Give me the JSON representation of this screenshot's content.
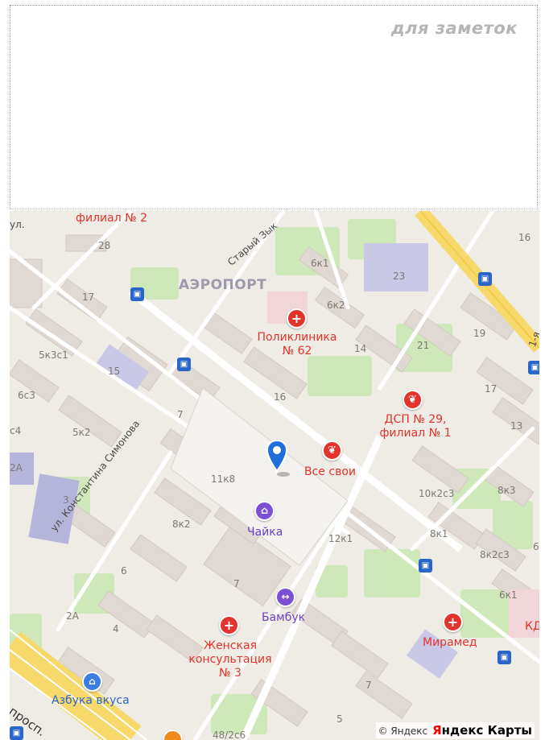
{
  "notes": {
    "label": "для заметок"
  },
  "map": {
    "district": "АЭРОПОРТ",
    "streets": {
      "simonova": "ул. Константина Симонова",
      "stary": "Старый Зык",
      "prosp": "просп.",
      "first": "1-я",
      "ul": "ул."
    },
    "pois": {
      "filial2": "филиал № 2",
      "poliklinika_l1": "Поликлиника",
      "poliklinika_l2": "№ 62",
      "dsp_l1": "ДСП № 29,",
      "dsp_l2": "филиал № 1",
      "vse_svoi": "Все свои",
      "chaika": "Чайка",
      "bambuk": "Бамбук",
      "zhenskaya_l1": "Женская",
      "zhenskaya_l2": "консультация",
      "zhenskaya_l3": "№ 3",
      "miramed": "Мирамед",
      "azbuka": "Азбука вкуса",
      "kd": "КД"
    },
    "buildings": {
      "b28": "28",
      "b16a": "16",
      "b6k1": "6к1",
      "b23": "23",
      "b17a": "17",
      "b6k2": "6к2",
      "b19": "19",
      "b5k3c1": "5к3с1",
      "b14": "14",
      "b21": "21",
      "b15": "15",
      "b16b": "16",
      "b17b": "17",
      "b6c3": "6с3",
      "b7a": "7",
      "b13": "13",
      "b5k2": "5к2",
      "c4": "с4",
      "a2": "2А",
      "b11k8": "11к8",
      "b10k2c3": "10к2с3",
      "b8k3": "8к3",
      "b3": "3",
      "b8k2": "8к2",
      "b12k1": "12к1",
      "b8k1": "8к1",
      "b8k2c3": "8к2с3",
      "b6": "6",
      "b7b": "7",
      "b6k1b": "6к1",
      "b2a": "2А",
      "b4": "4",
      "b7c": "7",
      "b5": "5",
      "b48": "48/2с6",
      "b6r": "6"
    },
    "copyright": "© Яндекс",
    "brand_ya": "Я",
    "brand_rest": "ндекс Карты"
  },
  "icons": {
    "pin": "location-pin-icon",
    "bus": "bus-stop-icon",
    "medical": "cross-icon",
    "dental": "tooth-icon",
    "theater": "hanger-icon",
    "sport": "dumbbell-icon",
    "shop": "basket-icon"
  }
}
